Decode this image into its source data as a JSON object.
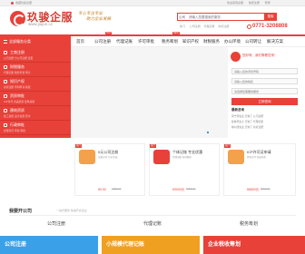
{
  "topbar": {
    "favorite": "收藏玖骏企服",
    "links": [
      "欢迎来到企服",
      "免费注册",
      "登录"
    ]
  },
  "logo": {
    "title": "玖骏企服",
    "url": "www.jiujun.cc",
    "slogan": [
      "专心专注专业",
      "助力企业发展"
    ]
  },
  "search": {
    "category": "公司",
    "placeholder": "请输入您要搜索的服务",
    "button": "搜索"
  },
  "hotline": {
    "items": [
      "热门:",
      "公司注册",
      "代理记账",
      "商标注册"
    ],
    "phone": "0771-3208808"
  },
  "nav": {
    "category_label": "全部服务分类",
    "items": [
      {
        "label": "首页",
        "badge": ""
      },
      {
        "label": "公司注册",
        "badge": "HOT"
      },
      {
        "label": "代理记账",
        "badge": ""
      },
      {
        "label": "许可审批",
        "badge": ""
      },
      {
        "label": "税务筹划",
        "badge": "NEW"
      },
      {
        "label": "知识产权",
        "badge": ""
      },
      {
        "label": "财税服务",
        "badge": ""
      },
      {
        "label": "办公环境",
        "badge": ""
      },
      {
        "label": "公司转让",
        "badge": ""
      },
      {
        "label": "解决方案",
        "badge": ""
      }
    ]
  },
  "sidebar": {
    "items": [
      {
        "title": "工商注册",
        "sub": "公司注册 分公司注册 变更"
      },
      {
        "title": "财税服务",
        "sub": "代理记账 税务筹划 审计"
      },
      {
        "title": "知识产权",
        "sub": "商标注册 专利申请 版权"
      },
      {
        "title": "资质审批",
        "sub": "ICP许可 食品经营 建筑资质"
      },
      {
        "title": "建筑资质",
        "sub": "施工资质 设计资质 安许"
      },
      {
        "title": "行政审批",
        "sub": "办理许可 年检 审批"
      }
    ]
  },
  "panel": {
    "welcome": "您好呀，我们等着您来！",
    "fields": [
      "请输入您的手机号码",
      "请输入您的姓名",
      "请选择您需要的服务"
    ],
    "submit": "立即咨询",
    "news_title": "最新咨询",
    "news": [
      "南宁周先生 咨询了 公司注册",
      "桂林李女士 咨询了 代理记账",
      "柳州张先生 咨询了 商标注册"
    ]
  },
  "cards": [
    {
      "label": "0元公司注册",
      "desc": "注册公司 专业 快速",
      "price": "¥0.00",
      "old": "¥1800.00",
      "ribbon": "热门",
      "color": "#f4a14b"
    },
    {
      "label": "个体记账 专业优惠",
      "desc": "代理记账 每月报税",
      "price": "¥3000元",
      "old": "¥4800.00",
      "ribbon": "热门",
      "color": "#e8413a"
    },
    {
      "label": "ICP许可证申请",
      "desc": "经营许可 快速办理",
      "price": "¥6800元",
      "old": "¥9000.00",
      "ribbon": "热门",
      "color": "#f4a14b"
    }
  ],
  "section": {
    "title": "我要开公司",
    "sub": "一站式服务 快速开办企业",
    "tabs": [
      "公司注册",
      "代理记账",
      "税务筹划"
    ],
    "tiles": [
      {
        "label": "公司注册",
        "color": "#3aa0e8"
      },
      {
        "label": "小规模代理记账",
        "color": "#f0a020"
      },
      {
        "label": "企业税收筹划",
        "color": "#e8413a"
      }
    ]
  },
  "colors": {
    "brand": "#e8413a",
    "text": "#333333"
  }
}
